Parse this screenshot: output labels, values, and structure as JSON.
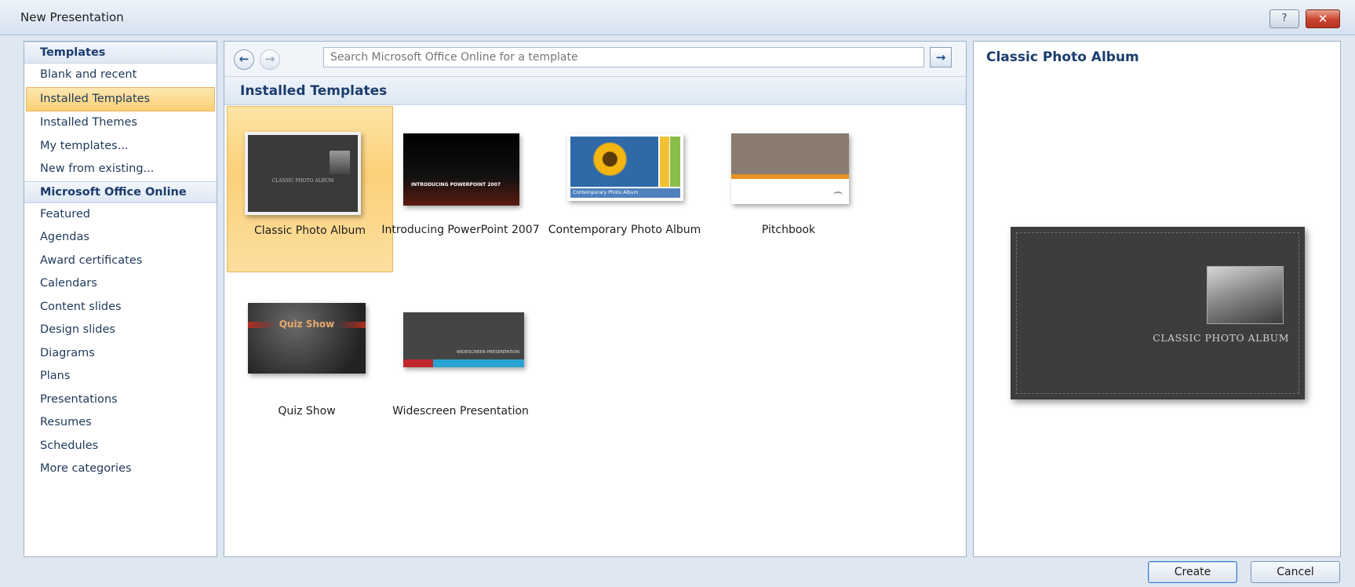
{
  "window": {
    "title": "New Presentation",
    "help_glyph": "?",
    "close_glyph": "✕"
  },
  "sidebar": {
    "items": [
      {
        "label": "Templates",
        "type": "header"
      },
      {
        "label": "Blank and recent",
        "type": "item"
      },
      {
        "label": "Installed Templates",
        "type": "selected"
      },
      {
        "label": "Installed Themes",
        "type": "item"
      },
      {
        "label": "My templates...",
        "type": "item"
      },
      {
        "label": "New from existing...",
        "type": "item"
      },
      {
        "label": "Microsoft Office Online",
        "type": "header"
      },
      {
        "label": "Featured",
        "type": "item"
      },
      {
        "label": "Agendas",
        "type": "item"
      },
      {
        "label": "Award certificates",
        "type": "item"
      },
      {
        "label": "Calendars",
        "type": "item"
      },
      {
        "label": "Content slides",
        "type": "item"
      },
      {
        "label": "Design slides",
        "type": "item"
      },
      {
        "label": "Diagrams",
        "type": "item"
      },
      {
        "label": "Plans",
        "type": "item"
      },
      {
        "label": "Presentations",
        "type": "item"
      },
      {
        "label": "Resumes",
        "type": "item"
      },
      {
        "label": "Schedules",
        "type": "item"
      },
      {
        "label": "More categories",
        "type": "item"
      }
    ]
  },
  "navbar": {
    "back_glyph": "←",
    "forward_glyph": "→",
    "search_placeholder": "Search Microsoft Office Online for a template",
    "go_glyph": "→"
  },
  "gallery": {
    "section_title": "Installed Templates",
    "templates": [
      {
        "label": "Classic Photo Album",
        "thumb_text": "CLASSIC PHOTO ALBUM",
        "selected": true
      },
      {
        "label": "Introducing PowerPoint 2007",
        "thumb_text": "INTRODUCING POWERPOINT 2007"
      },
      {
        "label": "Contemporary Photo Album",
        "thumb_text": "Contemporary Photo Album"
      },
      {
        "label": "Pitchbook",
        "thumb_text": ""
      },
      {
        "label": "Quiz Show",
        "thumb_text": "Quiz Show"
      },
      {
        "label": "Widescreen Presentation",
        "thumb_text": "WIDESCREEN PRESENTATION"
      }
    ]
  },
  "preview": {
    "title": "Classic Photo Album",
    "slide_text": "CLASSIC PHOTO ALBUM"
  },
  "buttons": {
    "create": "Create",
    "cancel": "Cancel"
  },
  "colors": {
    "accent": "#1b3d6e",
    "selection": "#fbcf74",
    "slide_dark": "#3d3d3d"
  }
}
